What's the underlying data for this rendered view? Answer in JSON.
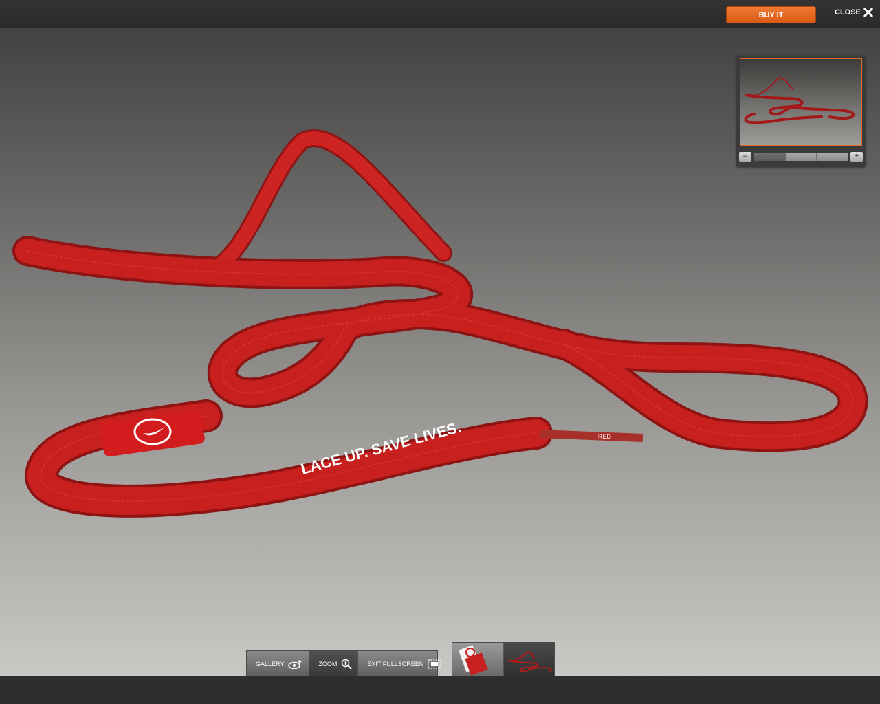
{
  "header": {
    "buy_label": "BUY IT",
    "close_label": "CLOSE"
  },
  "product": {
    "lace_print": "LACE UP. SAVE LIVES.",
    "aglet_print": "RED",
    "clip_print": "RED"
  },
  "zoom_control": {
    "minus_label": "–",
    "plus_label": "+",
    "level": 0
  },
  "toolbar": {
    "gallery_label": "GALLERY",
    "zoom_label": "ZOOM",
    "exit_label": "EXIT FULLSCREEN"
  },
  "colors": {
    "accent": "#e06a25",
    "lace": "#c8201f"
  },
  "icons": {
    "close": "close-icon",
    "gallery": "gallery-icon",
    "zoom": "zoom-icon",
    "exit": "exit-fullscreen-icon"
  }
}
